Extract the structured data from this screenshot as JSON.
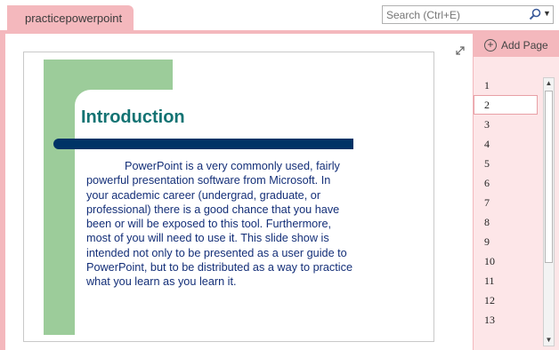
{
  "section": {
    "tab_label": "practicepowerpoint"
  },
  "search": {
    "placeholder": "Search (Ctrl+E)",
    "dropdown_glyph": "▼"
  },
  "page_panel": {
    "add_page_label": "Add Page",
    "plus_glyph": "+",
    "pages": [
      "1",
      "2",
      "3",
      "4",
      "5",
      "6",
      "7",
      "8",
      "9",
      "10",
      "11",
      "12",
      "13"
    ],
    "selected_index": 1
  },
  "scrollbar": {
    "up": "▲",
    "down": "▼"
  },
  "slide": {
    "title": "Introduction",
    "body": "PowerPoint is a very commonly used, fairly powerful presentation software from Microsoft. In your academic career (undergrad, graduate, or professional) there is a good chance that you have been or will be exposed to this tool. Furthermore, most of you will need to use it. This slide show is intended not only to be presented as a user guide to PowerPoint, but to be distributed as a way to practice what you learn as you learn it."
  },
  "colors": {
    "section_pink": "#f4b8bd",
    "panel_pink": "#fde6e8",
    "slide_green": "#9ccc9a",
    "title_teal": "#137373",
    "bar_navy": "#003366",
    "body_blue": "#142f78"
  },
  "icons": {
    "search": "magnifier-icon",
    "expand": "expand-arrows-icon",
    "add": "plus-circle-icon"
  }
}
